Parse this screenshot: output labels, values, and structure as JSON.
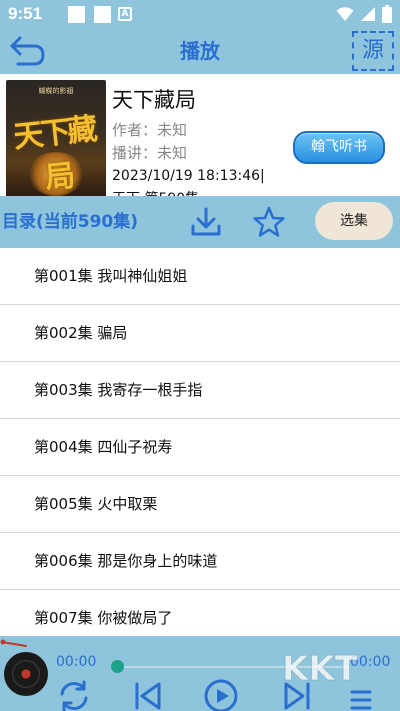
{
  "status_bar": {
    "time": "9:51",
    "notification_icon": "A"
  },
  "header": {
    "title": "播放",
    "source_label": "源"
  },
  "book": {
    "cover_small_text": "蝴蝶的影翅",
    "cover_title": "天下藏局",
    "title": "天下藏局",
    "author": "作者：未知",
    "narrator": "播讲：未知",
    "timestamp": "2023/10/19 18:13:46|",
    "latest_partial": "天下 第590集",
    "listen_button": "翰飞听书"
  },
  "catalog": {
    "title": "目录(当前590集)",
    "select_button": "选集",
    "episodes": [
      "第001集 我叫神仙姐姐",
      "第002集 骗局",
      "第003集 我寄存一根手指",
      "第004集 四仙子祝寿",
      "第005集 火中取栗",
      "第006集 那是你身上的味道",
      "第007集 你被做局了"
    ]
  },
  "player": {
    "current_time": "00:00",
    "total_time": "00:00",
    "progress": 0
  },
  "watermark": {
    "text": "KKT"
  },
  "colors": {
    "bar": "#8fc5dc",
    "accent": "#2a6fd0",
    "thumb": "#1aa38a"
  }
}
